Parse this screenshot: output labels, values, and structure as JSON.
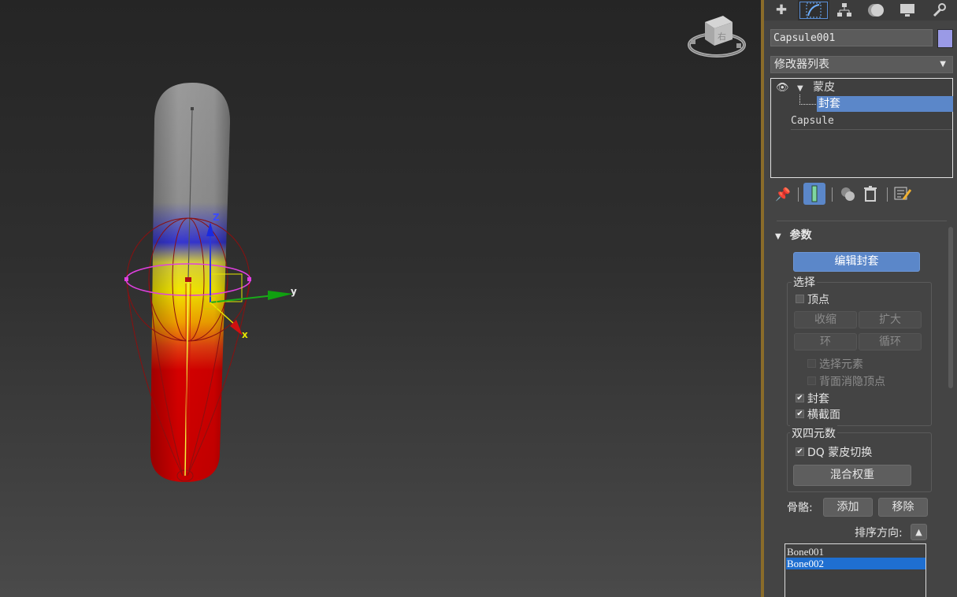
{
  "viewport": {
    "axis_labels": {
      "z": "Z",
      "y": "y",
      "x": "x"
    },
    "viewcube_face": "右"
  },
  "command_panel": {
    "tabs": [
      {
        "icon": "create-plus-icon"
      },
      {
        "icon": "modify-icon"
      },
      {
        "icon": "hierarchy-icon"
      },
      {
        "icon": "motion-icon"
      },
      {
        "icon": "display-icon"
      },
      {
        "icon": "utilities-wrench-icon"
      }
    ],
    "object_name": "Capsule001",
    "object_color": "#9a9ae6",
    "modifier_list_label": "修改器列表",
    "stack": {
      "modifier": "蒙皮",
      "sub_object": "封套",
      "base_object": "Capsule"
    },
    "parameters": {
      "title": "参数",
      "edit_envelopes": "编辑封套",
      "selection": {
        "title": "选择",
        "vertices": "顶点",
        "shrink": "收缩",
        "grow": "扩大",
        "ring": "环",
        "loop": "循环",
        "select_element": "选择元素",
        "backface_cull": "背面消隐顶点",
        "envelopes": "封套",
        "cross_sections": "横截面"
      },
      "dual_quaternion": {
        "title": "双四元数",
        "dq_toggle": "DQ 蒙皮切换",
        "blend_weights": "混合权重"
      },
      "bones_label": "骨骼:",
      "add": "添加",
      "remove": "移除",
      "sort_label": "排序方向:",
      "bones": [
        "Bone001",
        "Bone002"
      ],
      "selected_bone": "Bone002"
    },
    "check_states": {
      "vertices": false,
      "select_element": false,
      "backface_cull": false,
      "envelopes": true,
      "cross_sections": true,
      "dq_toggle": true
    }
  }
}
